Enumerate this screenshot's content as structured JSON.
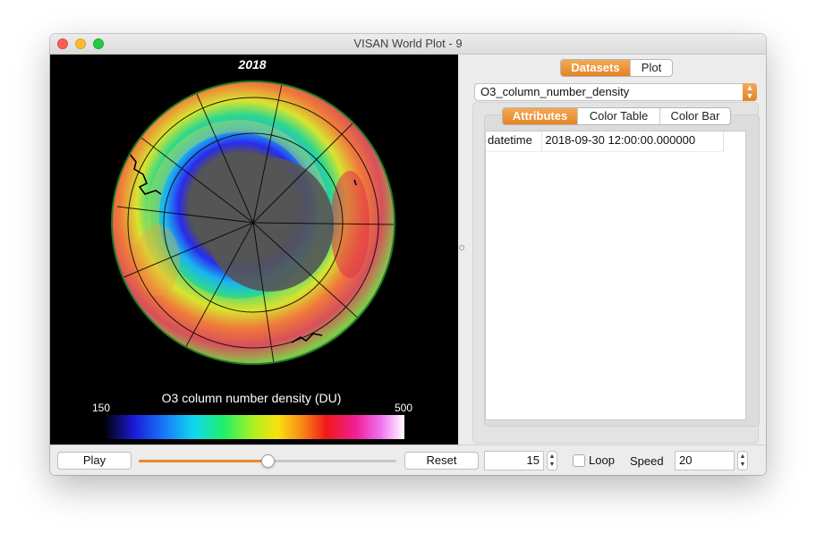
{
  "window": {
    "title": "VISAN World Plot - 9"
  },
  "plot": {
    "year_label": "2018",
    "colorbar_title": "O3 column number density (DU)",
    "colorbar_min": "150",
    "colorbar_max": "500"
  },
  "tabs": {
    "datasets": "Datasets",
    "plot": "Plot",
    "active": "Datasets"
  },
  "dataset_select": {
    "selected": "O3_column_number_density"
  },
  "subtabs": {
    "attributes": "Attributes",
    "color_table": "Color Table",
    "color_bar": "Color Bar",
    "active": "Attributes"
  },
  "attributes": [
    {
      "key": "datetime",
      "value": "2018-09-30 12:00:00.000000"
    }
  ],
  "controls": {
    "play_label": "Play",
    "reset_label": "Reset",
    "slider_position": 0.5,
    "frame_value": "15",
    "loop_label": "Loop",
    "loop_checked": false,
    "speed_label": "Speed",
    "speed_value": "20"
  },
  "colors": {
    "accent": "#e8892b"
  }
}
